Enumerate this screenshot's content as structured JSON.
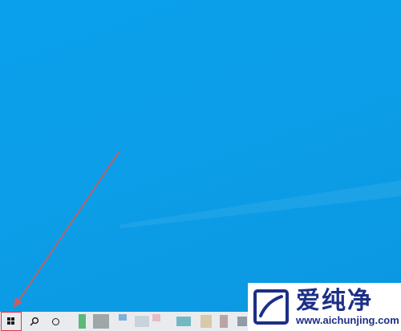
{
  "desktop": {
    "background_color": "#0aa0ec"
  },
  "annotation": {
    "arrow_color": "#d25a5a",
    "highlight_color": "#e0334a"
  },
  "taskbar": {
    "background_color": "#e9ebee",
    "start_button": {
      "icon": "windows-logo-icon"
    },
    "search_button": {
      "icon": "search-icon"
    },
    "cortana_button": {
      "icon": "cortana-circle-icon"
    },
    "pinned_apps": [
      {
        "icon": "app-icon-green",
        "color": "#5cb97a"
      },
      {
        "icon": "app-icon-gray",
        "color": "#9fa6a8"
      },
      {
        "icon": "app-icon-blue",
        "color": "#7fb0da"
      },
      {
        "icon": "app-icon-light",
        "color": "#c9d3dc"
      },
      {
        "icon": "app-icon-pink",
        "color": "#e6bcc8"
      },
      {
        "icon": "app-icon-teal",
        "color": "#74b8c4"
      },
      {
        "icon": "app-icon-tan",
        "color": "#d8c9a8"
      },
      {
        "icon": "app-icon-mauve",
        "color": "#b9a4a8"
      },
      {
        "icon": "app-icon-slate",
        "color": "#8f9ca6"
      }
    ]
  },
  "watermark": {
    "brand_cn": "爱纯净",
    "url": "www.aichunjing.com",
    "text_color": "#1d2f86"
  }
}
